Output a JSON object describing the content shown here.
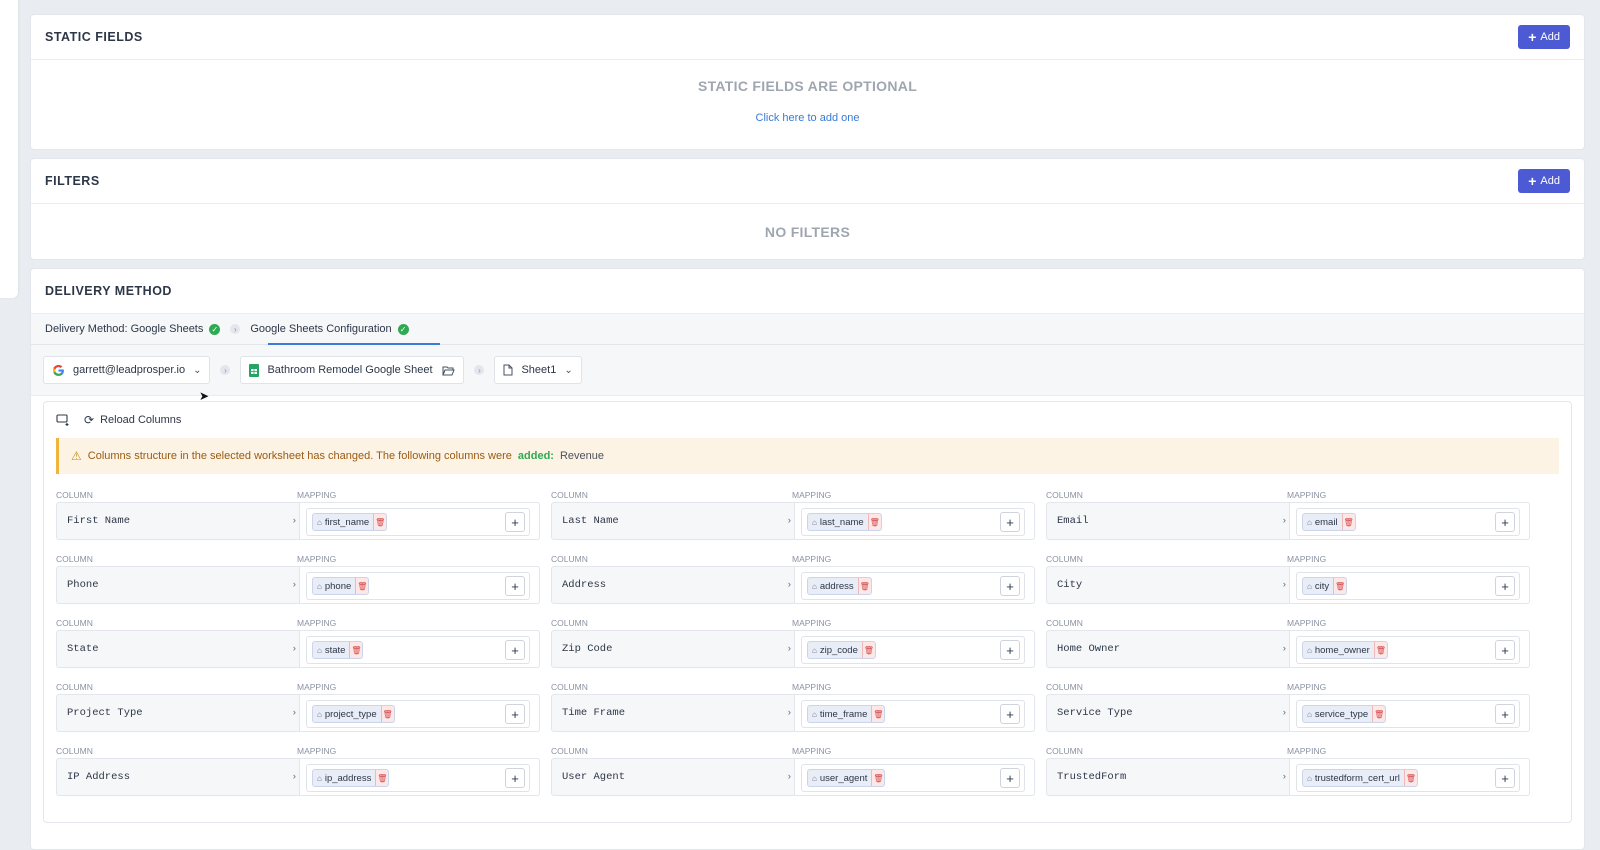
{
  "static_fields": {
    "title": "STATIC FIELDS",
    "add_label": "Add",
    "empty_text": "STATIC FIELDS ARE OPTIONAL",
    "link_text": "Click here to add one"
  },
  "filters": {
    "title": "FILTERS",
    "add_label": "Add",
    "empty_text": "NO FILTERS"
  },
  "delivery": {
    "title": "DELIVERY METHOD",
    "tabs": [
      {
        "label": "Delivery Method: Google Sheets"
      },
      {
        "label": "Google Sheets Configuration"
      }
    ],
    "account": "garrett@leadprosper.io",
    "spreadsheet": "Bathroom Remodel Google Sheet",
    "sheet": "Sheet1",
    "reload_label": "Reload Columns",
    "alert": {
      "text": "Columns structure in the selected worksheet has changed. The following columns were",
      "status": "added:",
      "columns": "Revenue"
    },
    "column_label": "COLUMN",
    "mapping_label": "MAPPING",
    "rows": [
      [
        {
          "column": "First Name",
          "mapping": "first_name"
        },
        {
          "column": "Last Name",
          "mapping": "last_name"
        },
        {
          "column": "Email",
          "mapping": "email"
        }
      ],
      [
        {
          "column": "Phone",
          "mapping": "phone"
        },
        {
          "column": "Address",
          "mapping": "address"
        },
        {
          "column": "City",
          "mapping": "city"
        }
      ],
      [
        {
          "column": "State",
          "mapping": "state"
        },
        {
          "column": "Zip Code",
          "mapping": "zip_code"
        },
        {
          "column": "Home Owner",
          "mapping": "home_owner"
        }
      ],
      [
        {
          "column": "Project Type",
          "mapping": "project_type"
        },
        {
          "column": "Time Frame",
          "mapping": "time_frame"
        },
        {
          "column": "Service Type",
          "mapping": "service_type"
        }
      ],
      [
        {
          "column": "IP Address",
          "mapping": "ip_address"
        },
        {
          "column": "User Agent",
          "mapping": "user_agent"
        },
        {
          "column": "TrustedForm",
          "mapping": "trustedform_cert_url"
        }
      ]
    ]
  }
}
